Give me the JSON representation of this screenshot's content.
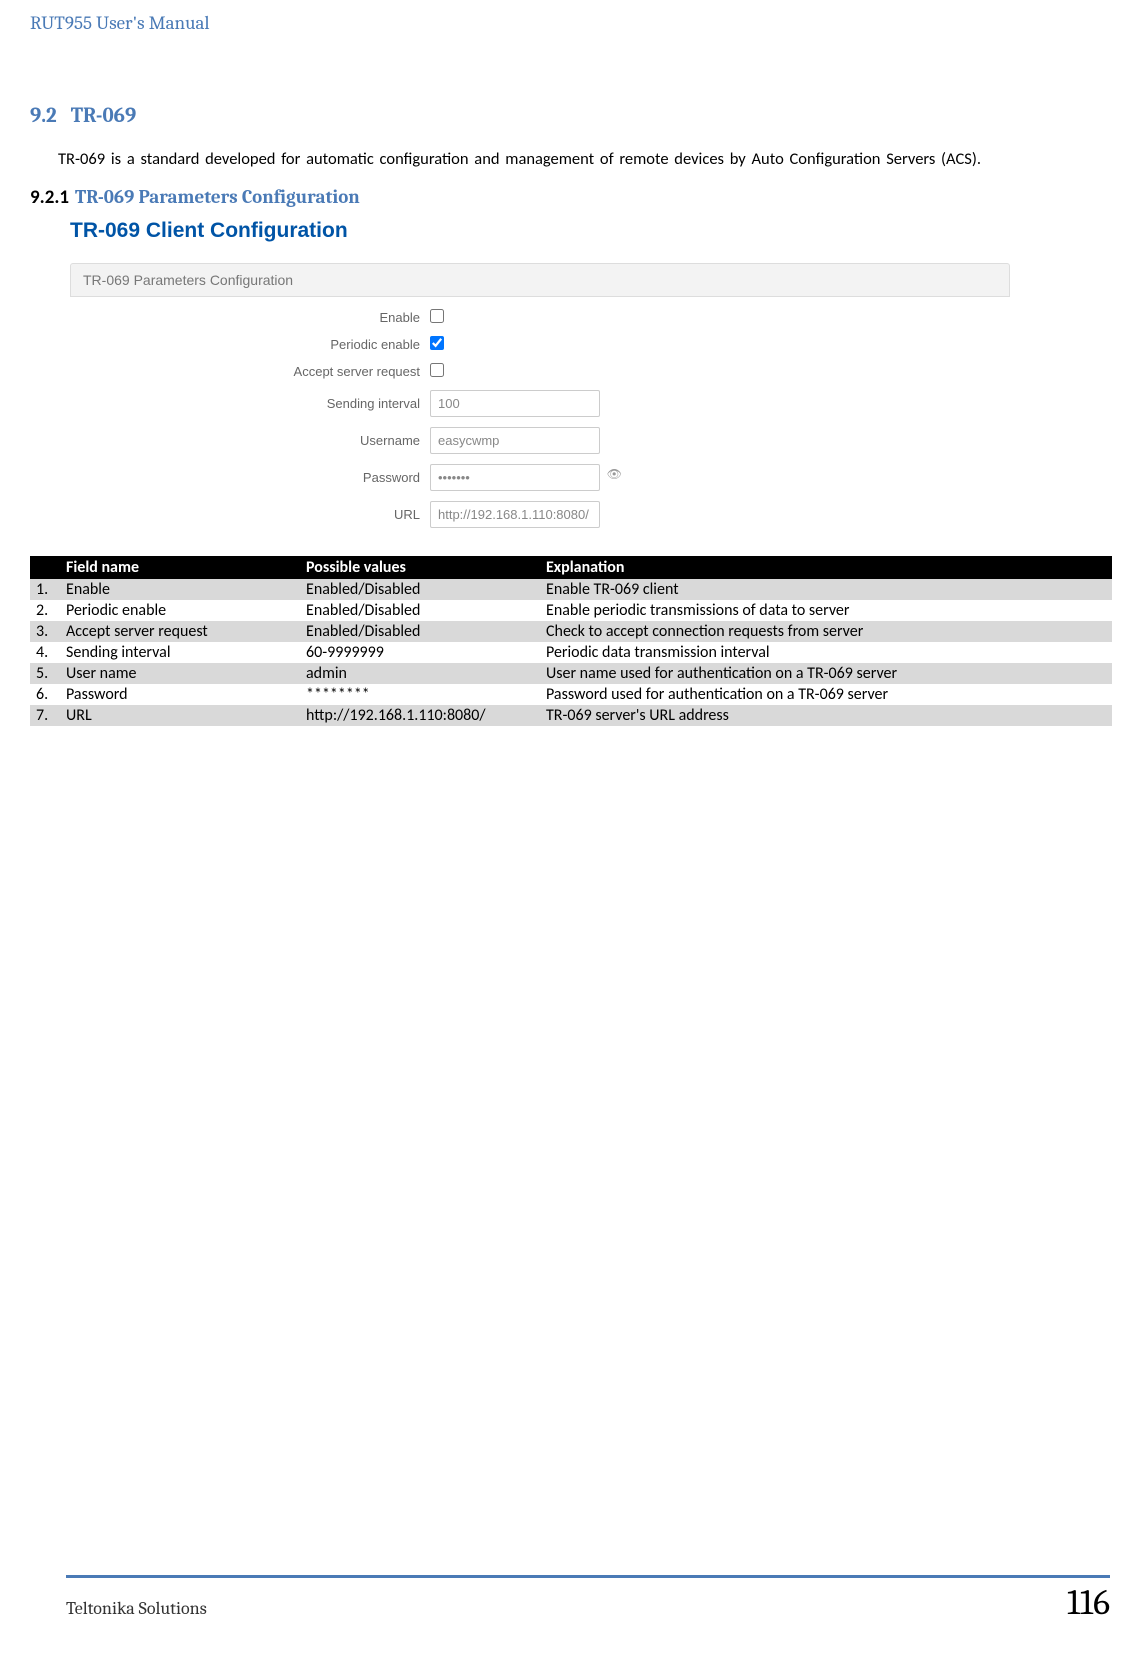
{
  "doc_header": "RUT955 User's Manual",
  "section": {
    "num": "9.2",
    "title": "TR-069",
    "body": "TR-069 is a standard developed for automatic configuration and management of remote devices by Auto Configuration Servers (ACS)."
  },
  "subsection": {
    "num": "9.2.1",
    "title": "TR-069 Parameters Configuration"
  },
  "form": {
    "title": "TR-069 Client Configuration",
    "panel": "TR-069 Parameters Configuration",
    "rows": {
      "enable": {
        "label": "Enable",
        "checked": false
      },
      "periodic": {
        "label": "Periodic enable",
        "checked": true
      },
      "accept": {
        "label": "Accept server request",
        "checked": false
      },
      "interval": {
        "label": "Sending interval",
        "value": "100"
      },
      "username": {
        "label": "Username",
        "value": "easycwmp"
      },
      "password": {
        "label": "Password",
        "value": "•••••••"
      },
      "url": {
        "label": "URL",
        "value": "http://192.168.1.110:8080/"
      }
    }
  },
  "table": {
    "headers": {
      "c0": "",
      "c1": "Field name",
      "c2": "Possible values",
      "c3": "Explanation"
    },
    "rows": [
      {
        "n": "1.",
        "f": "Enable",
        "p": "Enabled/Disabled",
        "e": "Enable TR-069 client"
      },
      {
        "n": "2.",
        "f": "Periodic enable",
        "p": "Enabled/Disabled",
        "e": "Enable periodic transmissions of data to server"
      },
      {
        "n": "3.",
        "f": "Accept server request",
        "p": "Enabled/Disabled",
        "e": "Check to accept connection requests from server"
      },
      {
        "n": "4.",
        "f": "Sending interval",
        "p": "60-9999999",
        "e": "Periodic data transmission interval"
      },
      {
        "n": "5.",
        "f": "User name",
        "p": "admin",
        "e": "User name used for authentication on a TR-069 server"
      },
      {
        "n": "6.",
        "f": "Password",
        "p": "********",
        "e": "Password used for authentication on a TR-069 server"
      },
      {
        "n": "7.",
        "f": "URL",
        "p": "http://192.168.1.110:8080/",
        "e": "TR-069 server's URL address"
      }
    ]
  },
  "footer": {
    "left": "Teltonika Solutions",
    "page": "116"
  }
}
